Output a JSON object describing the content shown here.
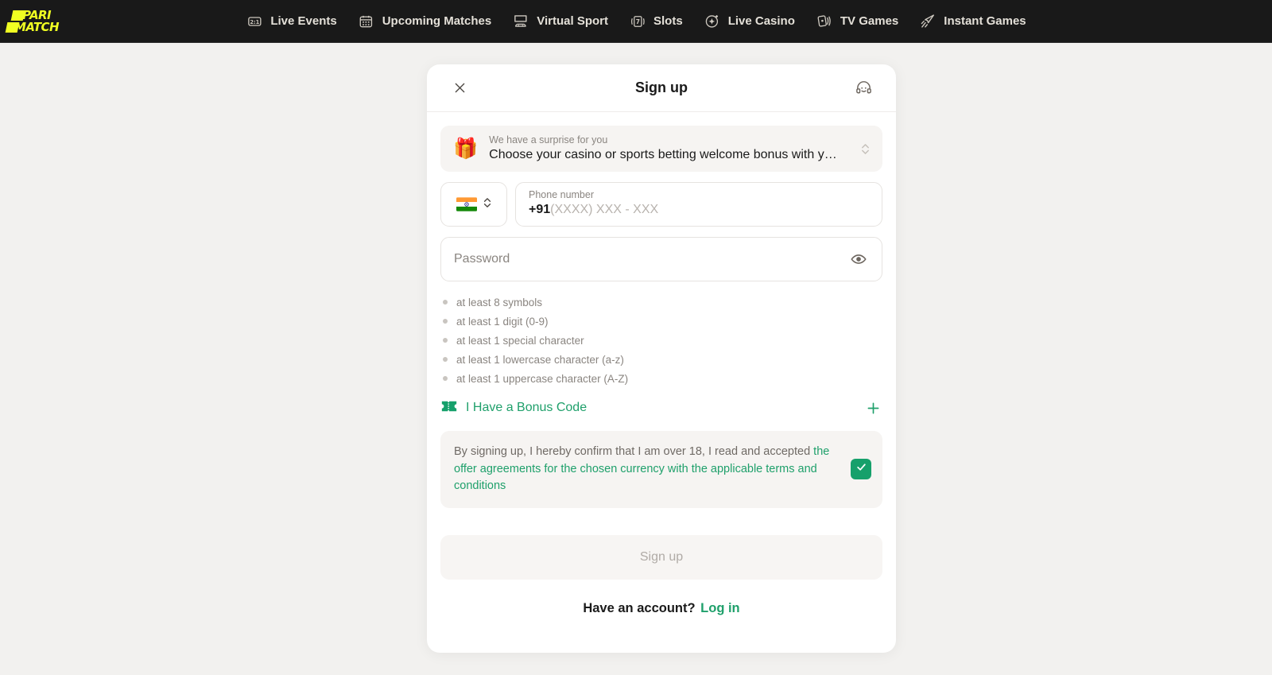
{
  "brand": {
    "logo_line1": "PARI",
    "logo_line2": "MATCH",
    "logo_color": "#f0ff22",
    "accent_green": "#1fa06b",
    "header_bg": "#191919",
    "page_bg": "#f2f1ef"
  },
  "nav": {
    "items": [
      {
        "label": "Live Events",
        "icon": "score-2-1-icon"
      },
      {
        "label": "Upcoming Matches",
        "icon": "calendar-icon"
      },
      {
        "label": "Virtual Sport",
        "icon": "gamepad-screen-icon"
      },
      {
        "label": "Slots",
        "icon": "slot-seven-icon"
      },
      {
        "label": "Live Casino",
        "icon": "sparkle-icon"
      },
      {
        "label": "TV Games",
        "icon": "playing-cards-icon"
      },
      {
        "label": "Instant Games",
        "icon": "rocket-icon"
      }
    ]
  },
  "modal": {
    "title": "Sign up",
    "close_icon": "close-icon",
    "support_icon": "support-headset-icon",
    "bonus": {
      "emoji": "🎁",
      "caption": "We have a surprise for you",
      "value": "Choose your casino or sports betting welcome bonus with y…",
      "chevron_icon": "chevron-up-down-icon"
    },
    "phone": {
      "flag_icon": "flag-india-icon",
      "country_chevron_icon": "chevron-up-down-icon",
      "label": "Phone number",
      "country_code": "+91",
      "placeholder": "(XXXX) XXX - XXX"
    },
    "password": {
      "placeholder": "Password",
      "toggle_icon": "eye-icon",
      "requirements": [
        "at least 8 symbols",
        "at least 1 digit (0-9)",
        "at least 1 special character",
        "at least 1 lowercase character (a-z)",
        "at least 1 uppercase character (A-Z)"
      ]
    },
    "bonus_code": {
      "label": "I Have a Bonus Code",
      "ticket_icon": "ticket-icon",
      "add_icon": "plus-icon"
    },
    "terms": {
      "lead": "By signing up, I hereby confirm that I am over 18, I read and accepted ",
      "link": "the offer agreements for the chosen currency with the applicable terms and conditions",
      "checked": true,
      "check_icon": "check-icon",
      "check_color": "#16a06b"
    },
    "submit": {
      "label": "Sign up",
      "enabled": false
    },
    "footer": {
      "question": "Have an account?",
      "login_label": "Log in"
    }
  }
}
